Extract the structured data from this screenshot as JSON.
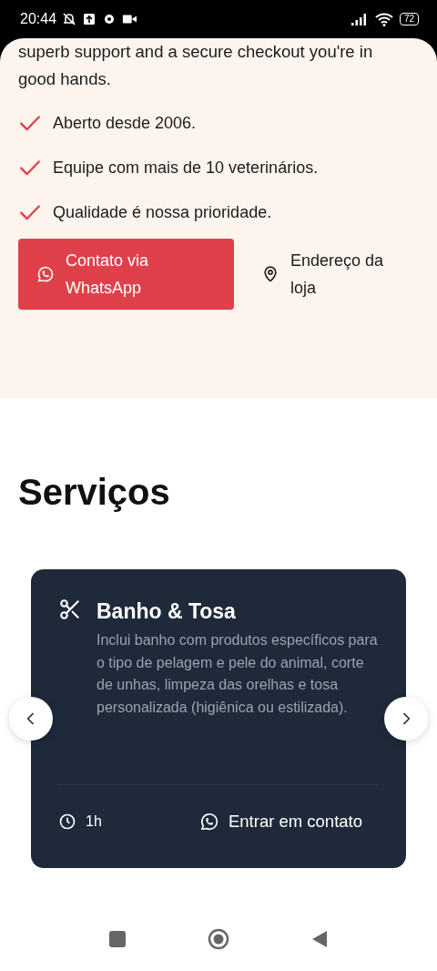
{
  "status_bar": {
    "time": "20:44",
    "battery": "72"
  },
  "intro": {
    "text": "superb support and a secure checkout you're in good hands."
  },
  "features": [
    {
      "text": "Aberto desde 2006."
    },
    {
      "text": "Equipe com mais de 10 veterinários."
    },
    {
      "text": "Qualidade é nossa prioridade."
    }
  ],
  "actions": [
    {
      "kind": "whatsapp",
      "label": "Contato via WhatsApp"
    },
    {
      "kind": "location",
      "label": "Endereço da loja"
    }
  ],
  "services": {
    "title": "Serviços",
    "card": {
      "title": "Banho & Tosa",
      "description": "Inclui banho com produtos específicos para o tipo de pelagem e pele do animal, corte de unhas, limpeza das orelhas e tosa personalizada (higiênica ou estilizada).",
      "duration": "1h",
      "contact": "Entrar em contato"
    }
  }
}
